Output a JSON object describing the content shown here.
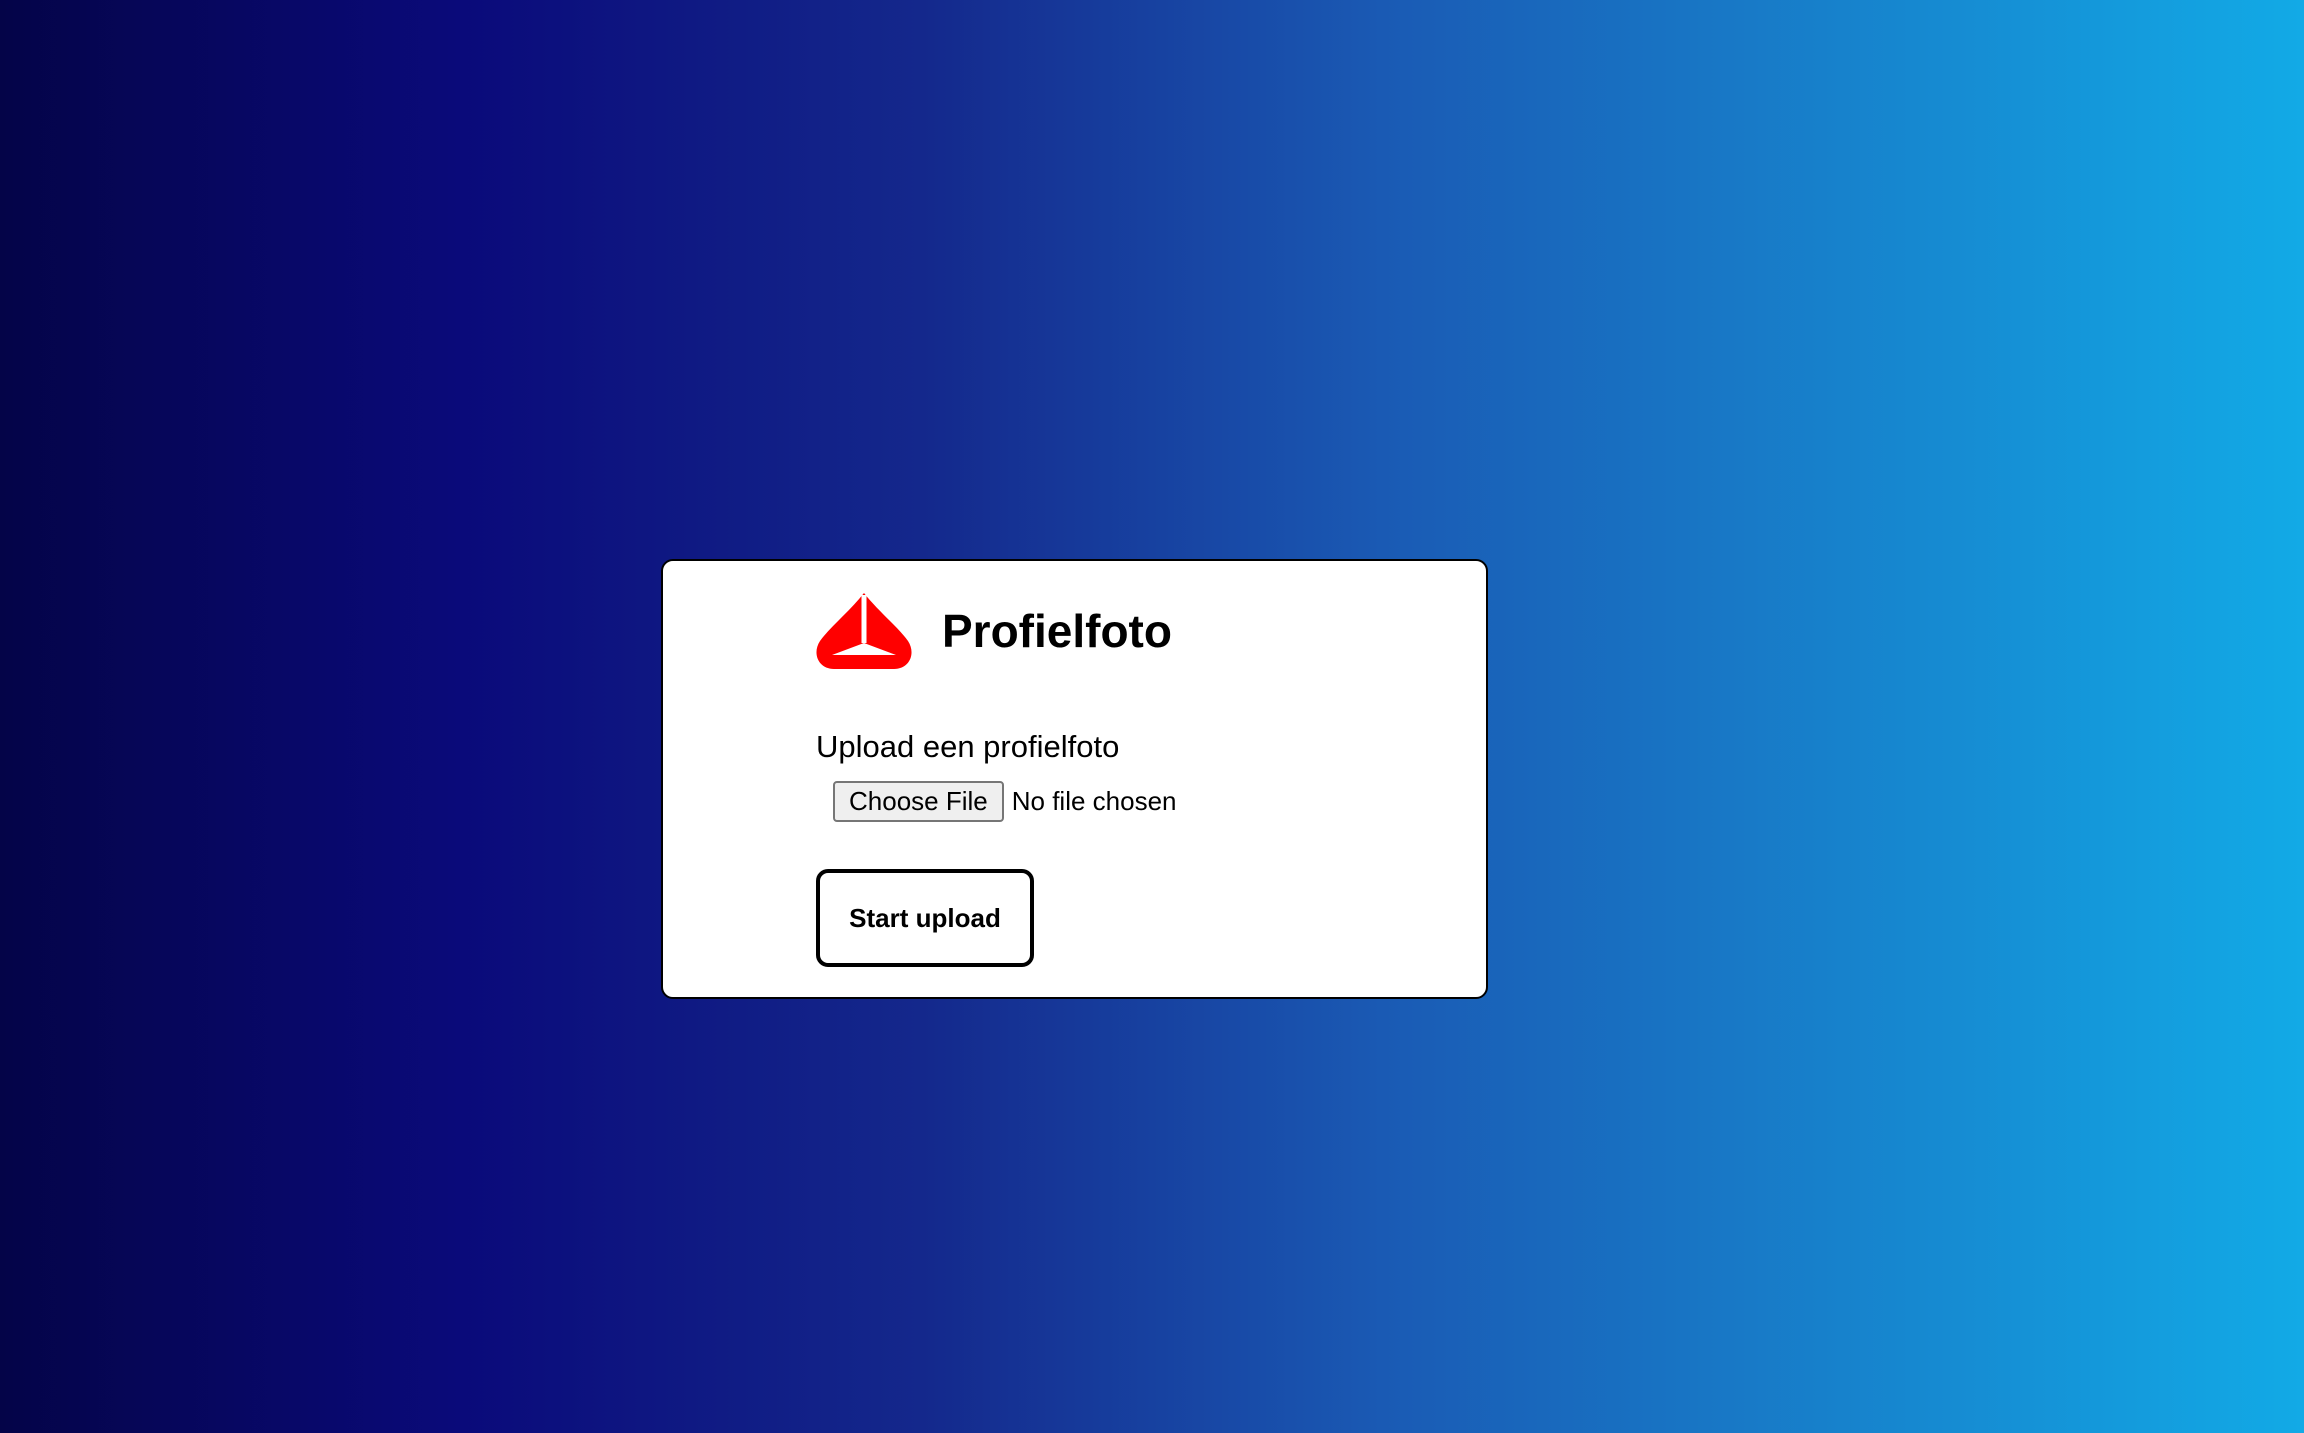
{
  "card": {
    "logo_icon": "red-triangle-logo",
    "logo_color": "#ff0000",
    "title": "Profielfoto",
    "upload_label": "Upload een profielfoto",
    "file_input": {
      "button_label": "Choose File",
      "status": "No file chosen"
    },
    "start_button_label": "Start upload"
  },
  "colors": {
    "background_gradient_start": "#040448",
    "background_gradient_end": "#12aae6",
    "card_background": "#ffffff",
    "text": "#000000"
  }
}
